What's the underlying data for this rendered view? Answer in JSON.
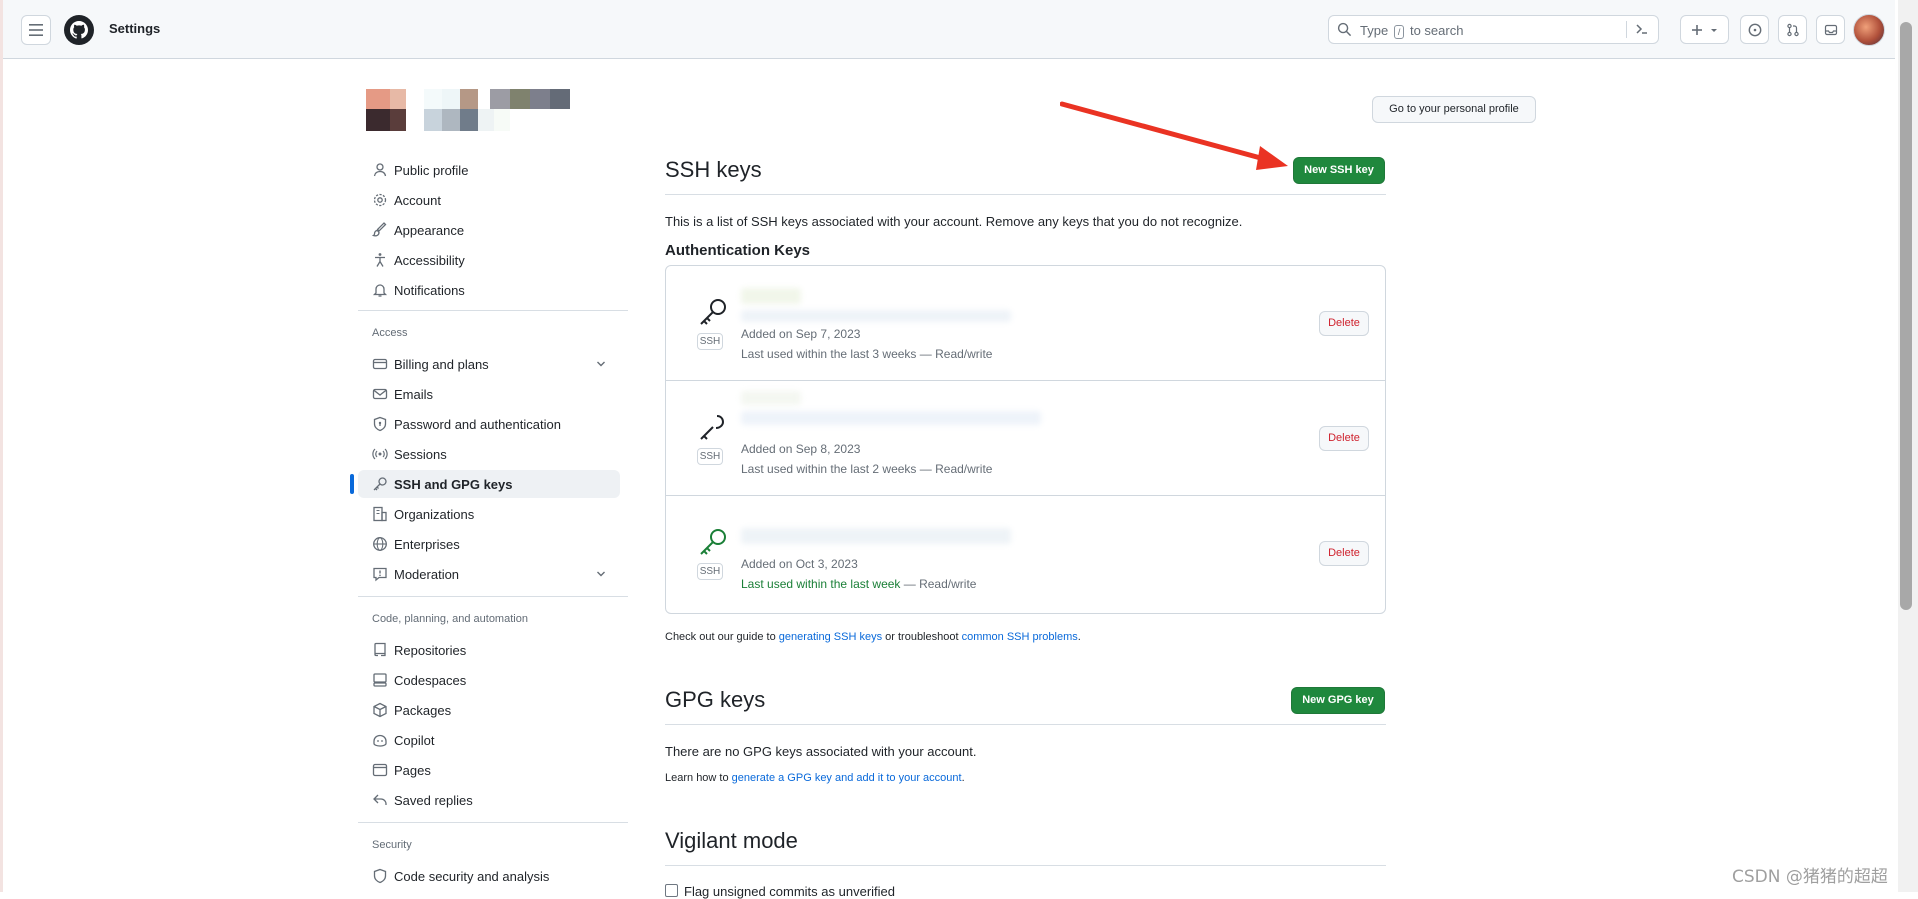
{
  "header": {
    "title": "Settings",
    "search_placeholder_pre": "Type",
    "search_key": "/",
    "search_placeholder_post": "to search",
    "command_glyph": ">_",
    "plus_glyph": "+"
  },
  "profile_button": "Go to your personal profile",
  "sidebar": {
    "items_top": [
      {
        "label": "Public profile",
        "icon": "person-icon"
      },
      {
        "label": "Account",
        "icon": "gear-icon"
      },
      {
        "label": "Appearance",
        "icon": "paintbrush-icon"
      },
      {
        "label": "Accessibility",
        "icon": "accessibility-icon"
      },
      {
        "label": "Notifications",
        "icon": "bell-icon"
      }
    ],
    "access_heading": "Access",
    "items_access": [
      {
        "label": "Billing and plans",
        "icon": "credit-card-icon",
        "expandable": true
      },
      {
        "label": "Emails",
        "icon": "mail-icon"
      },
      {
        "label": "Password and authentication",
        "icon": "shield-lock-icon"
      },
      {
        "label": "Sessions",
        "icon": "broadcast-icon"
      },
      {
        "label": "SSH and GPG keys",
        "icon": "key-icon",
        "active": true
      },
      {
        "label": "Organizations",
        "icon": "organization-icon"
      },
      {
        "label": "Enterprises",
        "icon": "globe-icon"
      },
      {
        "label": "Moderation",
        "icon": "report-icon",
        "expandable": true
      }
    ],
    "code_heading": "Code, planning, and automation",
    "items_code": [
      {
        "label": "Repositories",
        "icon": "repo-icon"
      },
      {
        "label": "Codespaces",
        "icon": "codespaces-icon"
      },
      {
        "label": "Packages",
        "icon": "package-icon"
      },
      {
        "label": "Copilot",
        "icon": "copilot-icon"
      },
      {
        "label": "Pages",
        "icon": "browser-icon"
      },
      {
        "label": "Saved replies",
        "icon": "reply-icon"
      }
    ],
    "security_heading": "Security",
    "items_security": [
      {
        "label": "Code security and analysis",
        "icon": "shield-icon"
      }
    ]
  },
  "ssh": {
    "title": "SSH keys",
    "new_button": "New SSH key",
    "description": "This is a list of SSH keys associated with your account. Remove any keys that you do not recognize.",
    "auth_heading": "Authentication Keys",
    "badge": "SSH",
    "delete_label": "Delete",
    "keys": [
      {
        "added": "Added on Sep 7, 2023",
        "used_pre": "Last used within the last 3 weeks",
        "used_post": " — Read/write",
        "recent": false
      },
      {
        "added": "Added on Sep 8, 2023",
        "used_pre": "Last used within the last 2 weeks",
        "used_post": " — Read/write",
        "recent": false
      },
      {
        "added": "Added on Oct 3, 2023",
        "used_pre": "Last used within the last week",
        "used_post": " — Read/write",
        "recent": true
      }
    ],
    "guide_pre": "Check out our guide to ",
    "guide_link1": "generating SSH keys",
    "guide_mid": " or troubleshoot ",
    "guide_link2": "common SSH problems",
    "guide_post": "."
  },
  "gpg": {
    "title": "GPG keys",
    "new_button": "New GPG key",
    "empty": "There are no GPG keys associated with your account.",
    "learn_pre": "Learn how to ",
    "learn_link": "generate a GPG key and add it to your account",
    "learn_post": "."
  },
  "vigilant": {
    "title": "Vigilant mode",
    "checkbox_label": "Flag unsigned commits as unverified"
  },
  "watermark": "CSDN @猪猪的超超",
  "colors": {
    "accent": "#0969da",
    "primary_button": "#1f883d",
    "danger": "#cf222e",
    "annotation_arrow": "#ea3323"
  }
}
